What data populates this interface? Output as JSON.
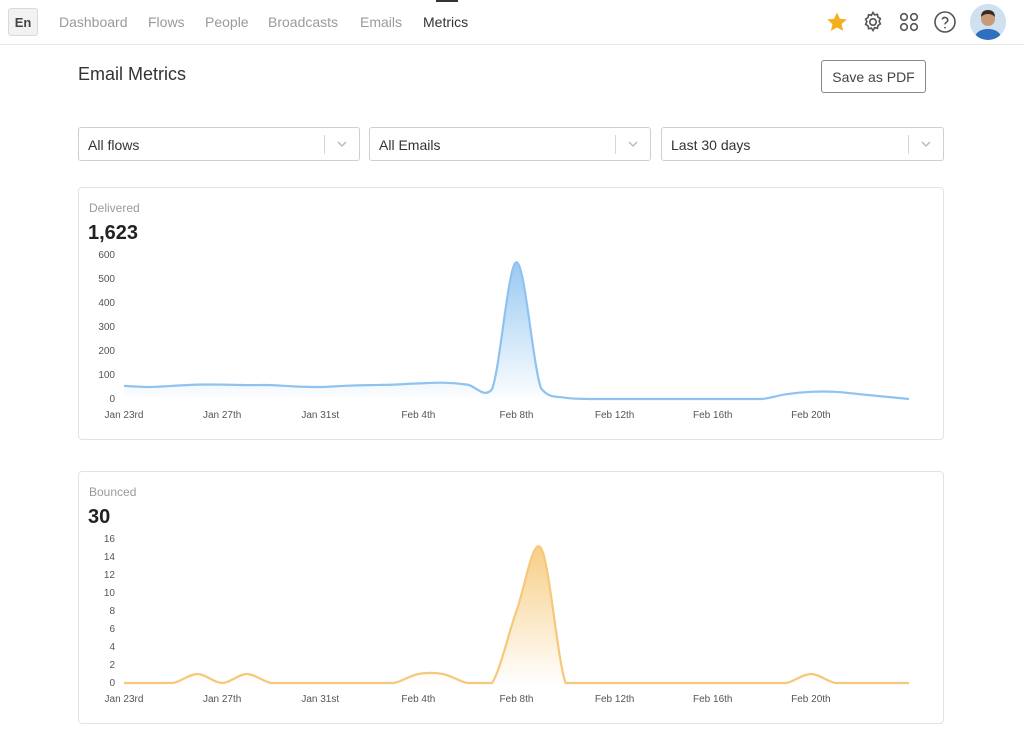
{
  "header": {
    "language": "En",
    "nav": [
      {
        "label": "Dashboard",
        "active": false
      },
      {
        "label": "Flows",
        "active": false
      },
      {
        "label": "People",
        "active": false
      },
      {
        "label": "Broadcasts",
        "active": false
      },
      {
        "label": "Emails",
        "active": false
      },
      {
        "label": "Metrics",
        "active": true
      }
    ],
    "icons": [
      "star-icon",
      "gear-icon",
      "apps-grid-icon",
      "help-icon"
    ],
    "accent_star": "#f2b01e"
  },
  "page": {
    "title": "Email Metrics",
    "save_pdf_label": "Save as PDF"
  },
  "filters": [
    {
      "value": "All flows"
    },
    {
      "value": "All Emails"
    },
    {
      "value": "Last 30 days"
    }
  ],
  "chart_data": [
    {
      "type": "area",
      "title": "Delivered",
      "total": "1,623",
      "color": "#8ec3f0",
      "ylim": [
        0,
        600
      ],
      "yticks": [
        0,
        100,
        200,
        300,
        400,
        500,
        600
      ],
      "xticks": [
        "Jan 23rd",
        "Jan 27th",
        "Jan 31st",
        "Feb 4th",
        "Feb 8th",
        "Feb 12th",
        "Feb 16th",
        "Feb 20th"
      ],
      "x": [
        "Jan 23",
        "Jan 24",
        "Jan 25",
        "Jan 26",
        "Jan 27",
        "Jan 28",
        "Jan 29",
        "Jan 30",
        "Jan 31",
        "Feb 1",
        "Feb 2",
        "Feb 3",
        "Feb 4",
        "Feb 5",
        "Feb 6",
        "Feb 7",
        "Feb 8",
        "Feb 9",
        "Feb 10",
        "Feb 11",
        "Feb 12",
        "Feb 13",
        "Feb 14",
        "Feb 15",
        "Feb 16",
        "Feb 17",
        "Feb 18",
        "Feb 19",
        "Feb 20",
        "Feb 21",
        "Feb 22",
        "Feb 23",
        "Feb 24"
      ],
      "values": [
        55,
        50,
        55,
        60,
        60,
        58,
        58,
        52,
        50,
        55,
        58,
        60,
        65,
        68,
        60,
        40,
        570,
        45,
        5,
        0,
        0,
        0,
        0,
        0,
        0,
        0,
        0,
        20,
        30,
        30,
        20,
        10,
        0
      ]
    },
    {
      "type": "area",
      "title": "Bounced",
      "total": "30",
      "color": "#f6c97a",
      "ylim": [
        0,
        16
      ],
      "yticks": [
        0,
        2,
        4,
        6,
        8,
        10,
        12,
        14,
        16
      ],
      "xticks": [
        "Jan 23rd",
        "Jan 27th",
        "Jan 31st",
        "Feb 4th",
        "Feb 8th",
        "Feb 12th",
        "Feb 16th",
        "Feb 20th"
      ],
      "x": [
        "Jan 23",
        "Jan 24",
        "Jan 25",
        "Jan 26",
        "Jan 27",
        "Jan 28",
        "Jan 29",
        "Jan 30",
        "Jan 31",
        "Feb 1",
        "Feb 2",
        "Feb 3",
        "Feb 4",
        "Feb 5",
        "Feb 6",
        "Feb 7",
        "Feb 8",
        "Feb 9",
        "Feb 10",
        "Feb 11",
        "Feb 12",
        "Feb 13",
        "Feb 14",
        "Feb 15",
        "Feb 16",
        "Feb 17",
        "Feb 18",
        "Feb 19",
        "Feb 20",
        "Feb 21",
        "Feb 22",
        "Feb 23",
        "Feb 24"
      ],
      "values": [
        0,
        0,
        0,
        1,
        0,
        1,
        0,
        0,
        0,
        0,
        0,
        0,
        1,
        1,
        0,
        0,
        8,
        15,
        0,
        0,
        0,
        0,
        0,
        0,
        0,
        0,
        0,
        0,
        1,
        0,
        0,
        0,
        0
      ]
    }
  ]
}
